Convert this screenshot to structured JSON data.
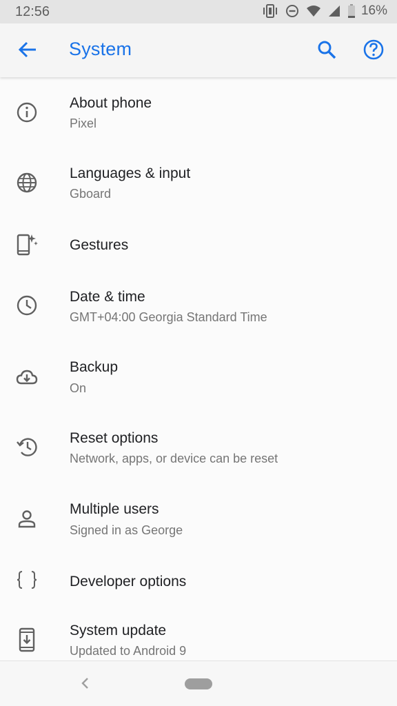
{
  "status_bar": {
    "time": "12:56",
    "battery": "16%",
    "icons": [
      "vibrate-icon",
      "do-not-disturb-icon",
      "wifi-icon",
      "cell-signal-icon",
      "battery-icon"
    ]
  },
  "app_bar": {
    "title": "System",
    "accent_color": "#1a73e8",
    "icons": [
      "back-arrow-icon",
      "search-icon",
      "help-icon"
    ]
  },
  "items": [
    {
      "label": "About phone",
      "sub": "Pixel",
      "icon": "info-icon"
    },
    {
      "label": "Languages & input",
      "sub": "Gboard",
      "icon": "globe-icon"
    },
    {
      "label": "Gestures",
      "sub": "",
      "icon": "gestures-icon"
    },
    {
      "label": "Date & time",
      "sub": "GMT+04:00 Georgia Standard Time",
      "icon": "clock-icon"
    },
    {
      "label": "Backup",
      "sub": "On",
      "icon": "cloud-backup-icon"
    },
    {
      "label": "Reset options",
      "sub": "Network, apps, or device can be reset",
      "icon": "history-icon"
    },
    {
      "label": "Multiple users",
      "sub": "Signed in as George",
      "icon": "person-icon"
    },
    {
      "label": "Developer options",
      "sub": "",
      "icon": "braces-icon"
    },
    {
      "label": "System update",
      "sub": "Updated to Android 9",
      "icon": "system-update-icon"
    }
  ],
  "nav_bar": {
    "icons": [
      "nav-back-icon",
      "nav-home-pill"
    ]
  }
}
